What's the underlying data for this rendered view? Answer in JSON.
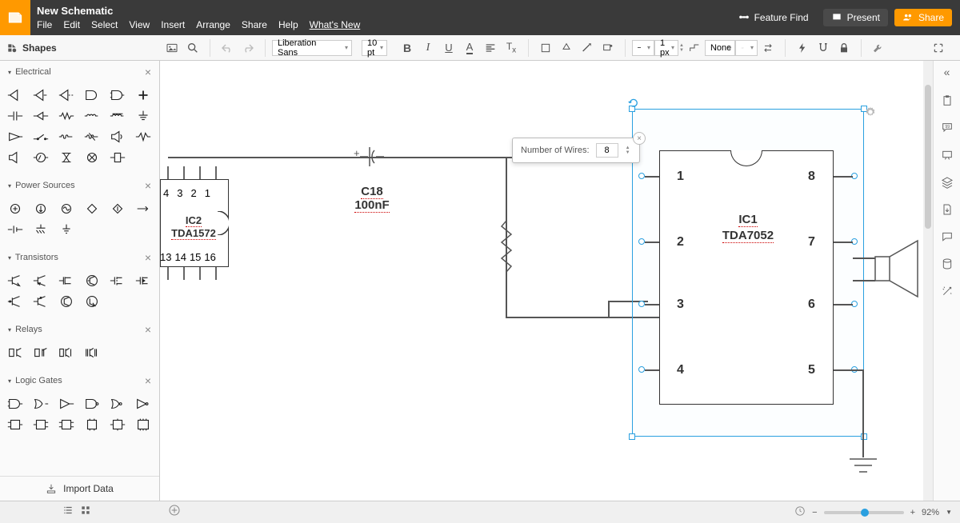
{
  "header": {
    "title": "New Schematic",
    "menu": [
      "File",
      "Edit",
      "Select",
      "View",
      "Insert",
      "Arrange",
      "Share",
      "Help",
      "What's New"
    ],
    "feature_find": "Feature Find",
    "present": "Present",
    "share": "Share"
  },
  "toolbar": {
    "shapes_label": "Shapes",
    "font": "Liberation Sans",
    "font_size": "10 pt",
    "line_w": "1 px",
    "line_style": "None"
  },
  "left": {
    "categories": [
      "Electrical",
      "Power Sources",
      "Transistors",
      "Relays",
      "Logic Gates"
    ],
    "import": "Import Data"
  },
  "popup": {
    "label": "Number of Wires:",
    "value": "8"
  },
  "ic1": {
    "name": "IC1",
    "part": "TDA7052",
    "pins": [
      "1",
      "2",
      "3",
      "4",
      "5",
      "6",
      "7",
      "8"
    ]
  },
  "ic2": {
    "name": "IC2",
    "part": "TDA1572",
    "pins_top": [
      "4",
      "3",
      "2",
      "1"
    ],
    "pins_bot": [
      "13",
      "14",
      "15",
      "16"
    ]
  },
  "cap": {
    "name": "C18",
    "val": "100nF"
  },
  "status": {
    "zoom": "92%"
  }
}
